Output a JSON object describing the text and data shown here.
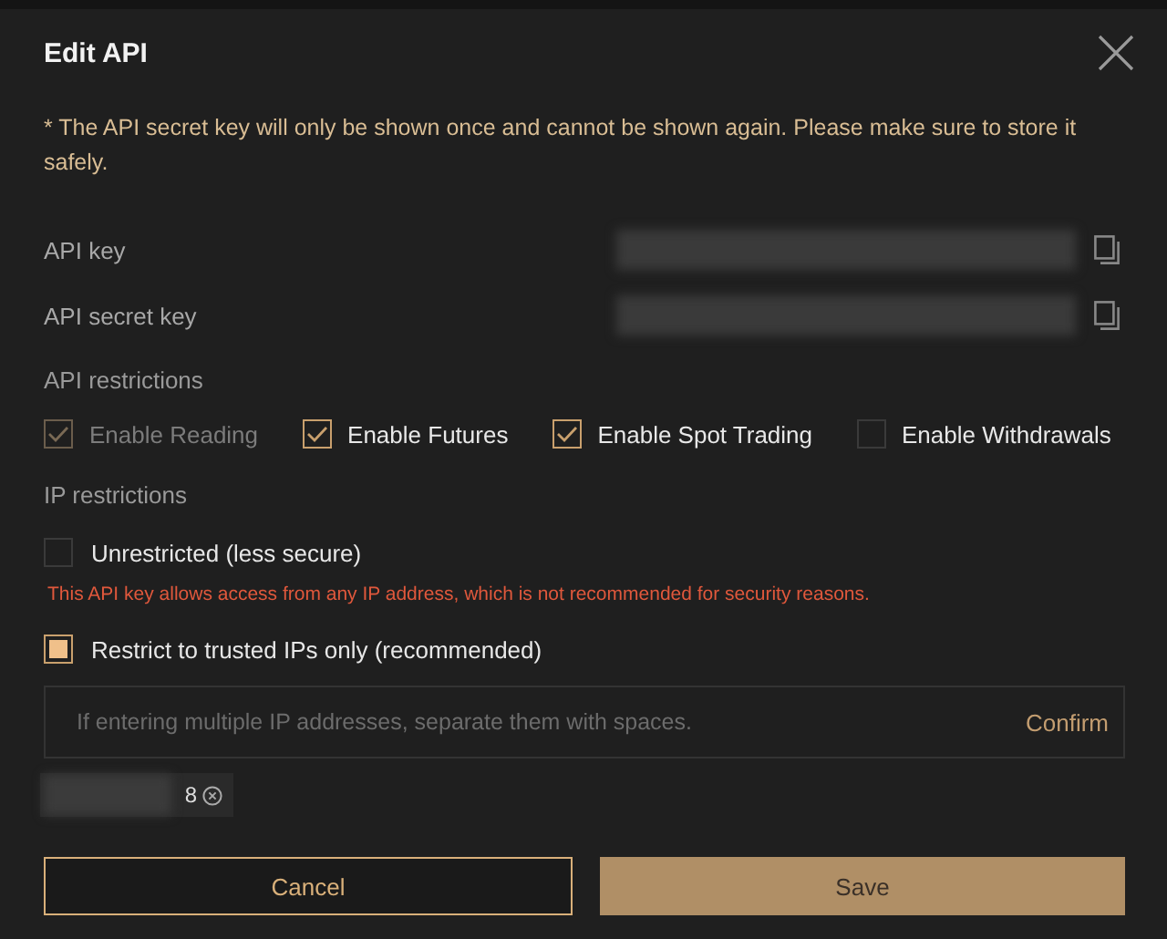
{
  "dialog": {
    "title": "Edit API"
  },
  "notice": "* The API secret key will only be shown once and cannot be shown again. Please make sure to store it safely.",
  "keys": [
    {
      "label": "API key"
    },
    {
      "label": "API secret key"
    }
  ],
  "api_restrictions": {
    "heading": "API restrictions",
    "options": [
      {
        "label": "Enable Reading",
        "checked": true,
        "disabled": true
      },
      {
        "label": "Enable Futures",
        "checked": true,
        "disabled": false
      },
      {
        "label": "Enable Spot Trading",
        "checked": true,
        "disabled": false
      },
      {
        "label": "Enable Withdrawals",
        "checked": false,
        "disabled": false
      }
    ]
  },
  "ip_restrictions": {
    "heading": "IP restrictions",
    "options": [
      {
        "label": "Unrestricted (less secure)",
        "selected": false,
        "warning": "This API key allows access from any IP address, which is not recommended for security reasons."
      },
      {
        "label": "Restrict to trusted IPs only (recommended)",
        "selected": true
      }
    ],
    "ip_field": {
      "placeholder": "If entering multiple IP addresses, separate them with spaces.",
      "confirm": "Confirm"
    },
    "ip_tags": [
      {
        "text": "8"
      }
    ]
  },
  "buttons": [
    {
      "label": "Cancel",
      "kind": "secondary"
    },
    {
      "label": "Save",
      "kind": "primary"
    }
  ]
}
